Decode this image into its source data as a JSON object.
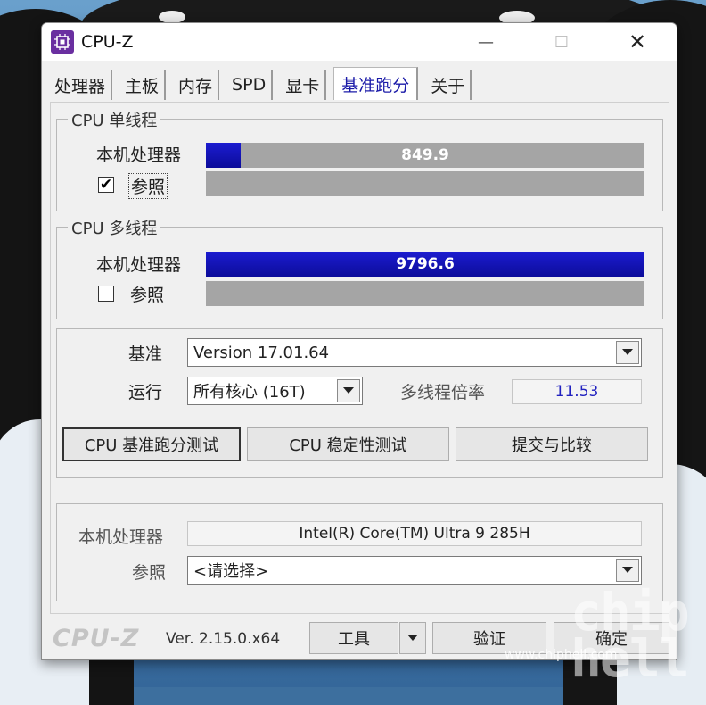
{
  "window": {
    "title": "CPU-Z",
    "controls": {
      "minimize": "—",
      "maximize": "☐",
      "close": "✕"
    }
  },
  "tabs": [
    {
      "label": "处理器"
    },
    {
      "label": "主板"
    },
    {
      "label": "内存"
    },
    {
      "label": "SPD"
    },
    {
      "label": "显卡"
    },
    {
      "label": "基准跑分",
      "active": true
    },
    {
      "label": "关于"
    }
  ],
  "single_thread": {
    "group_title": "CPU 单线程",
    "this_cpu_label": "本机处理器",
    "this_cpu_score": "849.9",
    "this_cpu_fill": 0.08,
    "reference_label": "参照",
    "reference_checked": true,
    "checkmark": "✔"
  },
  "multi_thread": {
    "group_title": "CPU 多线程",
    "this_cpu_label": "本机处理器",
    "this_cpu_score": "9796.6",
    "this_cpu_fill": 1.0,
    "reference_label": "参照",
    "reference_checked": false
  },
  "settings": {
    "benchmark_label": "基准",
    "benchmark_value": "Version 17.01.64",
    "run_label": "运行",
    "run_value": "所有核心 (16T)",
    "ratio_label": "多线程倍率",
    "ratio_value": "11.53"
  },
  "buttons": {
    "bench": "CPU 基准跑分测试",
    "stress": "CPU 稳定性测试",
    "submit": "提交与比较"
  },
  "cpu_info": {
    "this_label": "本机处理器",
    "this_value": "Intel(R) Core(TM) Ultra 9 285H",
    "ref_label": "参照",
    "ref_value": "<请选择>"
  },
  "footer": {
    "logo": "CPU-Z",
    "version": "Ver. 2.15.0.x64",
    "tools": "工具",
    "validate": "验证",
    "ok": "确定"
  },
  "watermark": {
    "chip": "chip",
    "hell": "hell",
    "url": "www.chiphell.com"
  },
  "colors": {
    "bar_fill": "#1414c0",
    "bar_empty": "#a5a5a5",
    "active_tab_text": "#1a1aa8",
    "ratio_text": "#2222c0"
  }
}
